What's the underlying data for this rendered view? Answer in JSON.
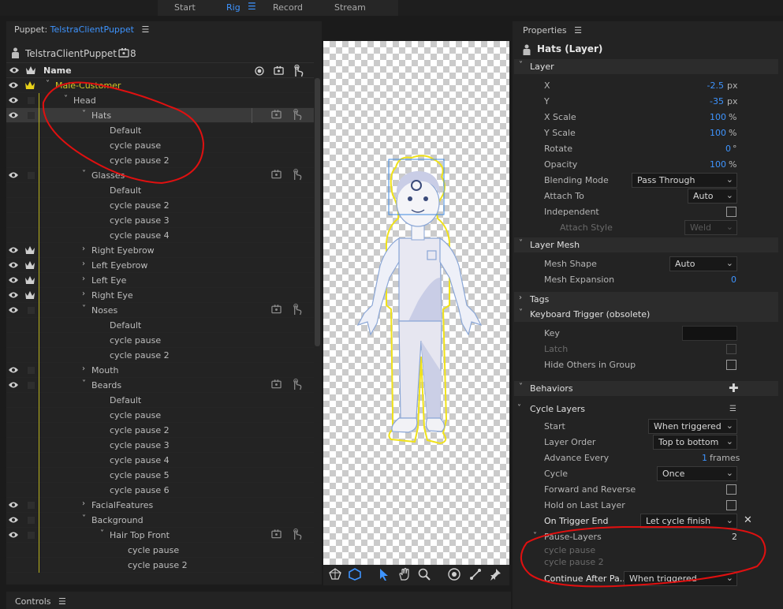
{
  "topbar": {
    "tabs": [
      {
        "label": "Start"
      },
      {
        "label": "Rig",
        "active": true
      },
      {
        "label": "Record"
      },
      {
        "label": "Stream"
      }
    ],
    "menu_glyph": "☰"
  },
  "puppet": {
    "panel_label": "Puppet:",
    "puppet_name": "TelstraClientPuppet",
    "menu_glyph": "☰",
    "root_name": "TelstraClientPuppet",
    "count": "8",
    "header_name": "Name"
  },
  "layers": [
    {
      "name": "Male-Customer",
      "indent": 0,
      "chev": "˅",
      "eye": true,
      "crown": "yellow",
      "green": true
    },
    {
      "name": "Head",
      "indent": 1,
      "chev": "˅",
      "eye": true
    },
    {
      "name": "Hats",
      "indent": 2,
      "chev": "˅",
      "eye": true,
      "selected": true,
      "icons": true
    },
    {
      "name": "Default",
      "indent": 3
    },
    {
      "name": "cycle pause",
      "indent": 3
    },
    {
      "name": "cycle pause 2",
      "indent": 3
    },
    {
      "name": "Glasses",
      "indent": 2,
      "chev": "˅",
      "eye": true,
      "icons": true
    },
    {
      "name": "Default",
      "indent": 3
    },
    {
      "name": "cycle pause 2",
      "indent": 3
    },
    {
      "name": "cycle pause 3",
      "indent": 3
    },
    {
      "name": "cycle pause 4",
      "indent": 3
    },
    {
      "name": "Right Eyebrow",
      "indent": 2,
      "chev": "›",
      "eye": true,
      "crown": "white"
    },
    {
      "name": "Left Eyebrow",
      "indent": 2,
      "chev": "›",
      "eye": true,
      "crown": "white"
    },
    {
      "name": "Left Eye",
      "indent": 2,
      "chev": "›",
      "eye": true,
      "crown": "white"
    },
    {
      "name": "Right Eye",
      "indent": 2,
      "chev": "›",
      "eye": true,
      "crown": "white"
    },
    {
      "name": "Noses",
      "indent": 2,
      "chev": "˅",
      "eye": true,
      "icons": true
    },
    {
      "name": "Default",
      "indent": 3
    },
    {
      "name": "cycle pause",
      "indent": 3
    },
    {
      "name": "cycle pause 2",
      "indent": 3
    },
    {
      "name": "Mouth",
      "indent": 2,
      "chev": "›",
      "eye": true
    },
    {
      "name": "Beards",
      "indent": 2,
      "chev": "˅",
      "eye": true,
      "icons": true
    },
    {
      "name": "Default",
      "indent": 3
    },
    {
      "name": "cycle pause",
      "indent": 3
    },
    {
      "name": "cycle pause 2",
      "indent": 3
    },
    {
      "name": "cycle pause 3",
      "indent": 3
    },
    {
      "name": "cycle pause 4",
      "indent": 3
    },
    {
      "name": "cycle pause 5",
      "indent": 3
    },
    {
      "name": "cycle pause 6",
      "indent": 3
    },
    {
      "name": "FacialFeatures",
      "indent": 2,
      "chev": "›",
      "eye": true
    },
    {
      "name": "Background",
      "indent": 2,
      "chev": "˅",
      "eye": true
    },
    {
      "name": "Hair Top Front",
      "indent": 3,
      "chev": "˅",
      "eye": true,
      "icons": true
    },
    {
      "name": "cycle pause",
      "indent": 4
    },
    {
      "name": "cycle pause 2",
      "indent": 4
    }
  ],
  "properties": {
    "title": "Properties",
    "menu_glyph": "☰",
    "subject": "Hats (Layer)",
    "layer": {
      "section": "Layer",
      "x": {
        "label": "X",
        "value": "-2.5",
        "unit": "px"
      },
      "y": {
        "label": "Y",
        "value": "-35",
        "unit": "px"
      },
      "xscale": {
        "label": "X Scale",
        "value": "100",
        "unit": "%"
      },
      "yscale": {
        "label": "Y Scale",
        "value": "100",
        "unit": "%"
      },
      "rotate": {
        "label": "Rotate",
        "value": "0",
        "unit": "°"
      },
      "opacity": {
        "label": "Opacity",
        "value": "100",
        "unit": "%"
      },
      "blending": {
        "label": "Blending Mode",
        "value": "Pass Through"
      },
      "attach_to": {
        "label": "Attach To",
        "value": "Auto"
      },
      "independent": {
        "label": "Independent"
      },
      "attach_style": {
        "label": "Attach Style",
        "value": "Weld"
      }
    },
    "mesh": {
      "section": "Layer Mesh",
      "shape": {
        "label": "Mesh Shape",
        "value": "Auto"
      },
      "expansion": {
        "label": "Mesh Expansion",
        "value": "0"
      }
    },
    "tags": {
      "section": "Tags"
    },
    "trigger": {
      "section": "Keyboard Trigger (obsolete)",
      "key": {
        "label": "Key"
      },
      "latch": {
        "label": "Latch"
      },
      "hide": {
        "label": "Hide Others in Group"
      }
    },
    "behaviors": {
      "section": "Behaviors",
      "add": "✚"
    },
    "cycle": {
      "title": "Cycle Layers",
      "start": {
        "label": "Start",
        "value": "When triggered"
      },
      "order": {
        "label": "Layer Order",
        "value": "Top to bottom"
      },
      "advance": {
        "label": "Advance Every",
        "value": "1",
        "unit": "frames"
      },
      "cycle": {
        "label": "Cycle",
        "value": "Once"
      },
      "fwdrev": {
        "label": "Forward and Reverse"
      },
      "hold": {
        "label": "Hold on Last Layer"
      },
      "trigger_end": {
        "label": "On Trigger End",
        "value": "Let cycle finish",
        "clear": "✕"
      },
      "pause_layers": {
        "label": "Pause-Layers",
        "count": "2",
        "items": [
          "cycle pause",
          "cycle pause 2"
        ]
      },
      "continue": {
        "label": "Continue After Pa...",
        "value": "When triggered"
      }
    }
  },
  "controls": {
    "label": "Controls",
    "menu_glyph": "☰"
  },
  "colors": {
    "accent": "#3e94ff",
    "layer_green": "#d2c826",
    "annotation": "#e01010"
  }
}
